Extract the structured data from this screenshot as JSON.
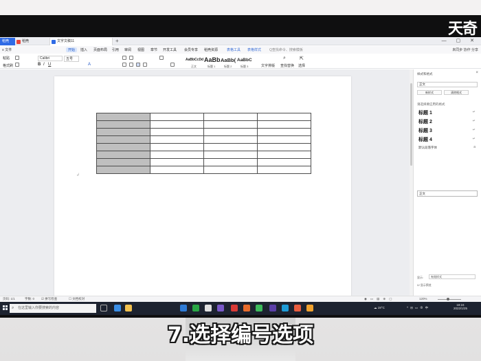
{
  "watermark": "天奇",
  "subtitle": "7.选择编号选项",
  "tabs": {
    "home": "稻壳",
    "doc1": "稻壳",
    "doc2": "文字文稿11",
    "plus": "+"
  },
  "window_controls": "— ▢ ✕",
  "menu": {
    "file": "≡ 文件",
    "items": [
      "开始",
      "插入",
      "页面布局",
      "引用",
      "审阅",
      "视图",
      "章节",
      "开发工具",
      "会员专享",
      "稻壳资源",
      "表格工具",
      "表格样式"
    ],
    "active_index": 0,
    "search": "Q查找命令、搜索模板",
    "right": "未同步  协作  分享"
  },
  "ribbon": {
    "font_name": "Calibri",
    "font_size": "五号",
    "styles": [
      {
        "sample": "AaBbCcDd",
        "label": "正文"
      },
      {
        "sample": "AaBb",
        "label": "标题 1"
      },
      {
        "sample": "AaBb(",
        "label": "标题 2"
      },
      {
        "sample": "AaBbC",
        "label": "标题 3"
      }
    ],
    "text_tools": "文字排版",
    "find_replace": "查找替换",
    "select": "选择",
    "paste": "粘贴",
    "format_painter": "格式刷"
  },
  "panel": {
    "title": "样式和格式",
    "current": "正文",
    "new_style": "新样式",
    "clear_format": "清除格式",
    "section": "请选择要应用的格式",
    "styles": [
      "标题 1",
      "标题 2",
      "标题 3",
      "标题 4"
    ],
    "default_para": "默认段落字体",
    "selected": "正文",
    "show_label": "显示:",
    "show_value": "有效样式",
    "preview": "显示预览"
  },
  "status": {
    "page": "页码: 1/1",
    "words": "字数: 0",
    "spell": "拼写检查",
    "doc_check": "文档校对",
    "zoom": "120%"
  },
  "taskbar": {
    "search_placeholder": "在这里输入你要搜索的内容",
    "weather": "19°C",
    "time": "18:24",
    "date": "2022/1/25"
  },
  "colors": {
    "accent": "#2f6be5",
    "selected_cell": "#bfbfbf",
    "taskbar": "#1d2330"
  }
}
